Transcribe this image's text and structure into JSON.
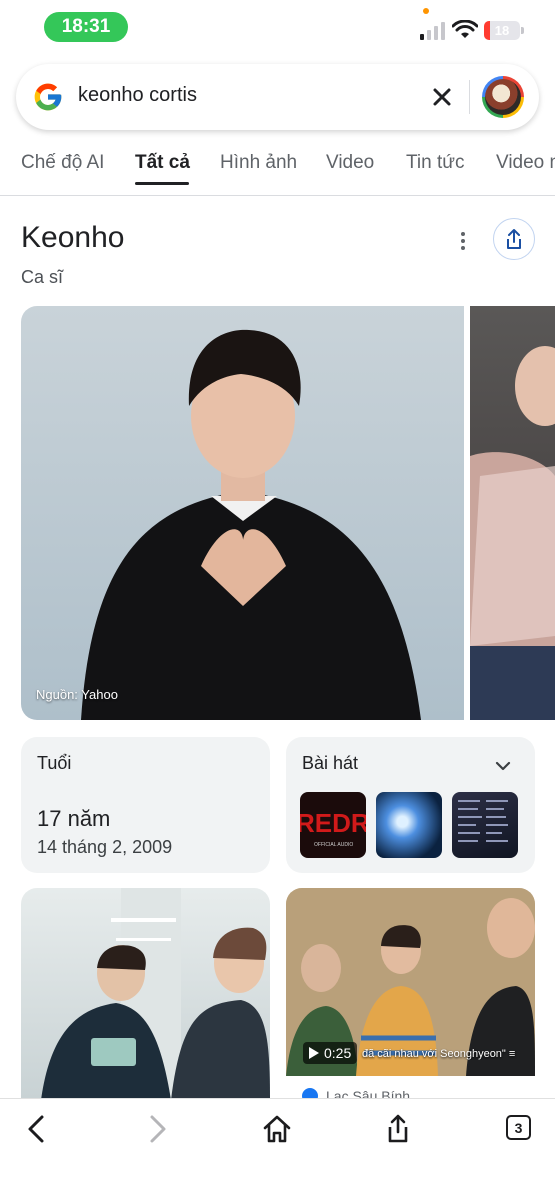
{
  "status_bar": {
    "time": "18:31",
    "battery": "18",
    "battery_level": 0.18
  },
  "search": {
    "query": "keonho cortis"
  },
  "tabs": [
    {
      "label": "Chế độ AI"
    },
    {
      "label": "Tất cả",
      "active": true
    },
    {
      "label": "Hình ảnh"
    },
    {
      "label": "Video"
    },
    {
      "label": "Tin tức"
    },
    {
      "label": "Video n"
    }
  ],
  "entity": {
    "name": "Keonho",
    "subtitle": "Ca sĩ",
    "image_source": "Nguồn: Yahoo"
  },
  "age_card": {
    "label": "Tuổi",
    "value": "17 năm",
    "birth_date": "14 tháng 2, 2009"
  },
  "songs_card": {
    "label": "Bài hát",
    "thumbs": [
      "REDRE",
      "OFFICIAL AUDIO"
    ]
  },
  "video_result": {
    "duration": "0:25",
    "caption": "đã cãi nhau với Seonghyeon\" ≡",
    "channel": "Lạc Sâu Bính"
  },
  "toolbar": {
    "tabs_count": "3"
  },
  "colors": {
    "accent_green": "#34c759",
    "google_blue": "#4285f4",
    "battery_red": "#ff3b30"
  }
}
